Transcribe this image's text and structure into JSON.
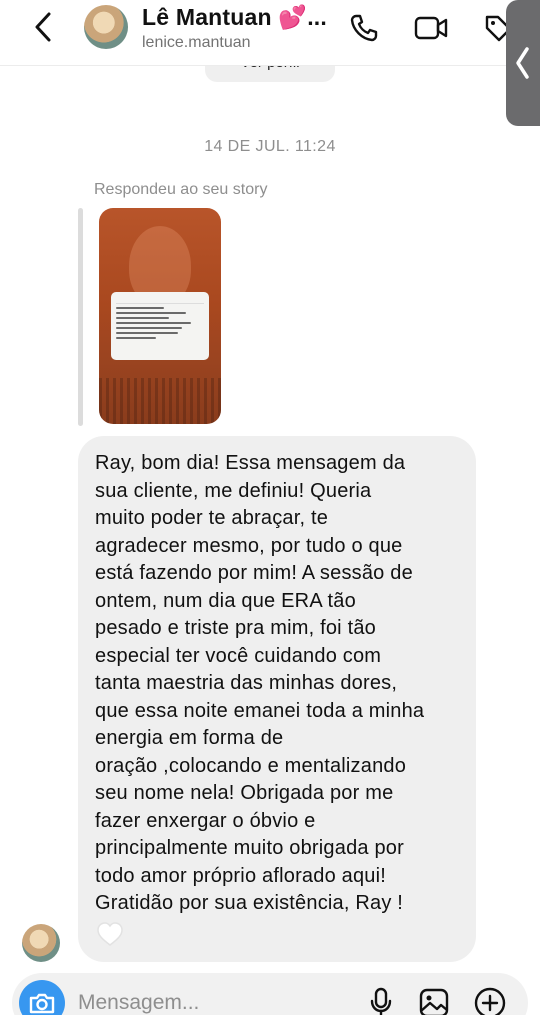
{
  "header": {
    "contact_name": "Lê Mantuan 💕...",
    "contact_handle": "lenice.mantuan",
    "icons": [
      "back-icon",
      "phone-icon",
      "video-icon",
      "tag-icon"
    ]
  },
  "side_tab": {
    "glyph": "❮"
  },
  "thread": {
    "previous_chip": "Ver perfil",
    "date_separator": "14 DE JUL. 11:24",
    "replied_label": "Respondeu ao seu story",
    "message": "Ray, bom dia! Essa mensagem da\nsua cliente, me definiu! Queria\nmuito poder te abraçar, te\nagradecer mesmo, por tudo o que\nestá fazendo por mim! A sessão de\nontem, num dia que ERA tão\npesado e triste pra mim, foi tão\nespecial ter você cuidando com\ntanta maestria das minhas dores,\nque essa noite emanei toda a minha\nenergia em forma de\noração ,colocando e mentalizando\nseu nome nela! Obrigada por me\nfazer enxergar o óbvio e\nprincipalmente muito obrigada por\ntodo amor próprio aflorado aqui!\nGratidão por sua existência, Ray !"
  },
  "composer": {
    "placeholder": "Mensagem...",
    "icons": [
      "camera-icon",
      "microphone-icon",
      "gallery-icon",
      "add-icon"
    ]
  },
  "colors": {
    "accent": "#3797f0",
    "bubble": "#efefef",
    "muted_text": "#8e8e8e"
  }
}
